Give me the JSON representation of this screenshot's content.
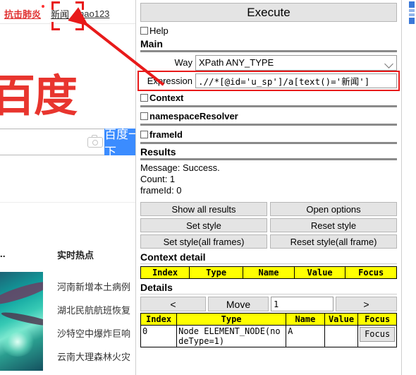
{
  "background_page": {
    "nav_links": [
      {
        "label": "抗击肺炎",
        "style": "red-bold",
        "has_dot": true
      },
      {
        "label": "新闻",
        "style": "dark"
      },
      {
        "label": "hao123",
        "style": "plain"
      }
    ],
    "logo_text": "百度",
    "logo_visible_fragment": "度",
    "search_placeholder": "",
    "search_button_label": "百度一下",
    "search_button_visible_fragment": "百",
    "camera_icon": "camera-icon",
    "card_title_fragment": "鱼...",
    "hot_section_title": "实时热点",
    "hot_items": [
      "河南新增本土病例",
      "湖北民航航班恢复",
      "沙特空中爆炸巨响",
      "云南大理森林火灾"
    ]
  },
  "panel": {
    "execute_label": "Execute",
    "help_label": "Help",
    "help_checked": false,
    "main_heading": "Main",
    "way_label": "Way",
    "way_value": "XPath ANY_TYPE",
    "way_chevron": "chevron-down-icon",
    "expression_label": "Expression",
    "expression_value": ".//*[@id='u_sp']/a[text()='新闻']",
    "context_label": "Context",
    "context_checked": false,
    "namespace_label": "namespaceResolver",
    "namespace_checked": false,
    "frameid_label": "frameId",
    "frameid_checked": false,
    "results_heading": "Results",
    "results_lines": [
      "Message: Success.",
      "Count: 1",
      "frameId: 0"
    ],
    "action_buttons": [
      "Show all results",
      "Open options",
      "Set style",
      "Reset style",
      "Set style(all frames)",
      "Reset style(all frame)"
    ],
    "context_detail_heading": "Context detail",
    "context_detail_columns": [
      "Index",
      "Type",
      "Name",
      "Value",
      "Focus"
    ],
    "context_detail_rows": [],
    "details_heading": "Details",
    "move_prev_label": "<",
    "move_label": "Move",
    "move_value": "1",
    "move_next_label": ">",
    "details_columns": [
      "Index",
      "Type",
      "Name",
      "Value",
      "Focus"
    ],
    "details_rows": [
      {
        "index": "0",
        "type": "Node ELEMENT_NODE(nodeType=1)",
        "name": "A",
        "value": "",
        "focus_label": "Focus"
      }
    ]
  },
  "annotations": {
    "highlight_color": "#e81a1a",
    "highlight_target": "新闻",
    "arrow_from": "expression-field",
    "arrow_to": "news-link-highlight"
  },
  "colors": {
    "accent_red": "#e81a1a",
    "baidu_red": "#e8352e",
    "baidu_blue": "#3b8cff",
    "table_header_yellow": "#ffff00",
    "button_gray": "#e4e4e4",
    "rule_gray": "#8a8a8a"
  }
}
